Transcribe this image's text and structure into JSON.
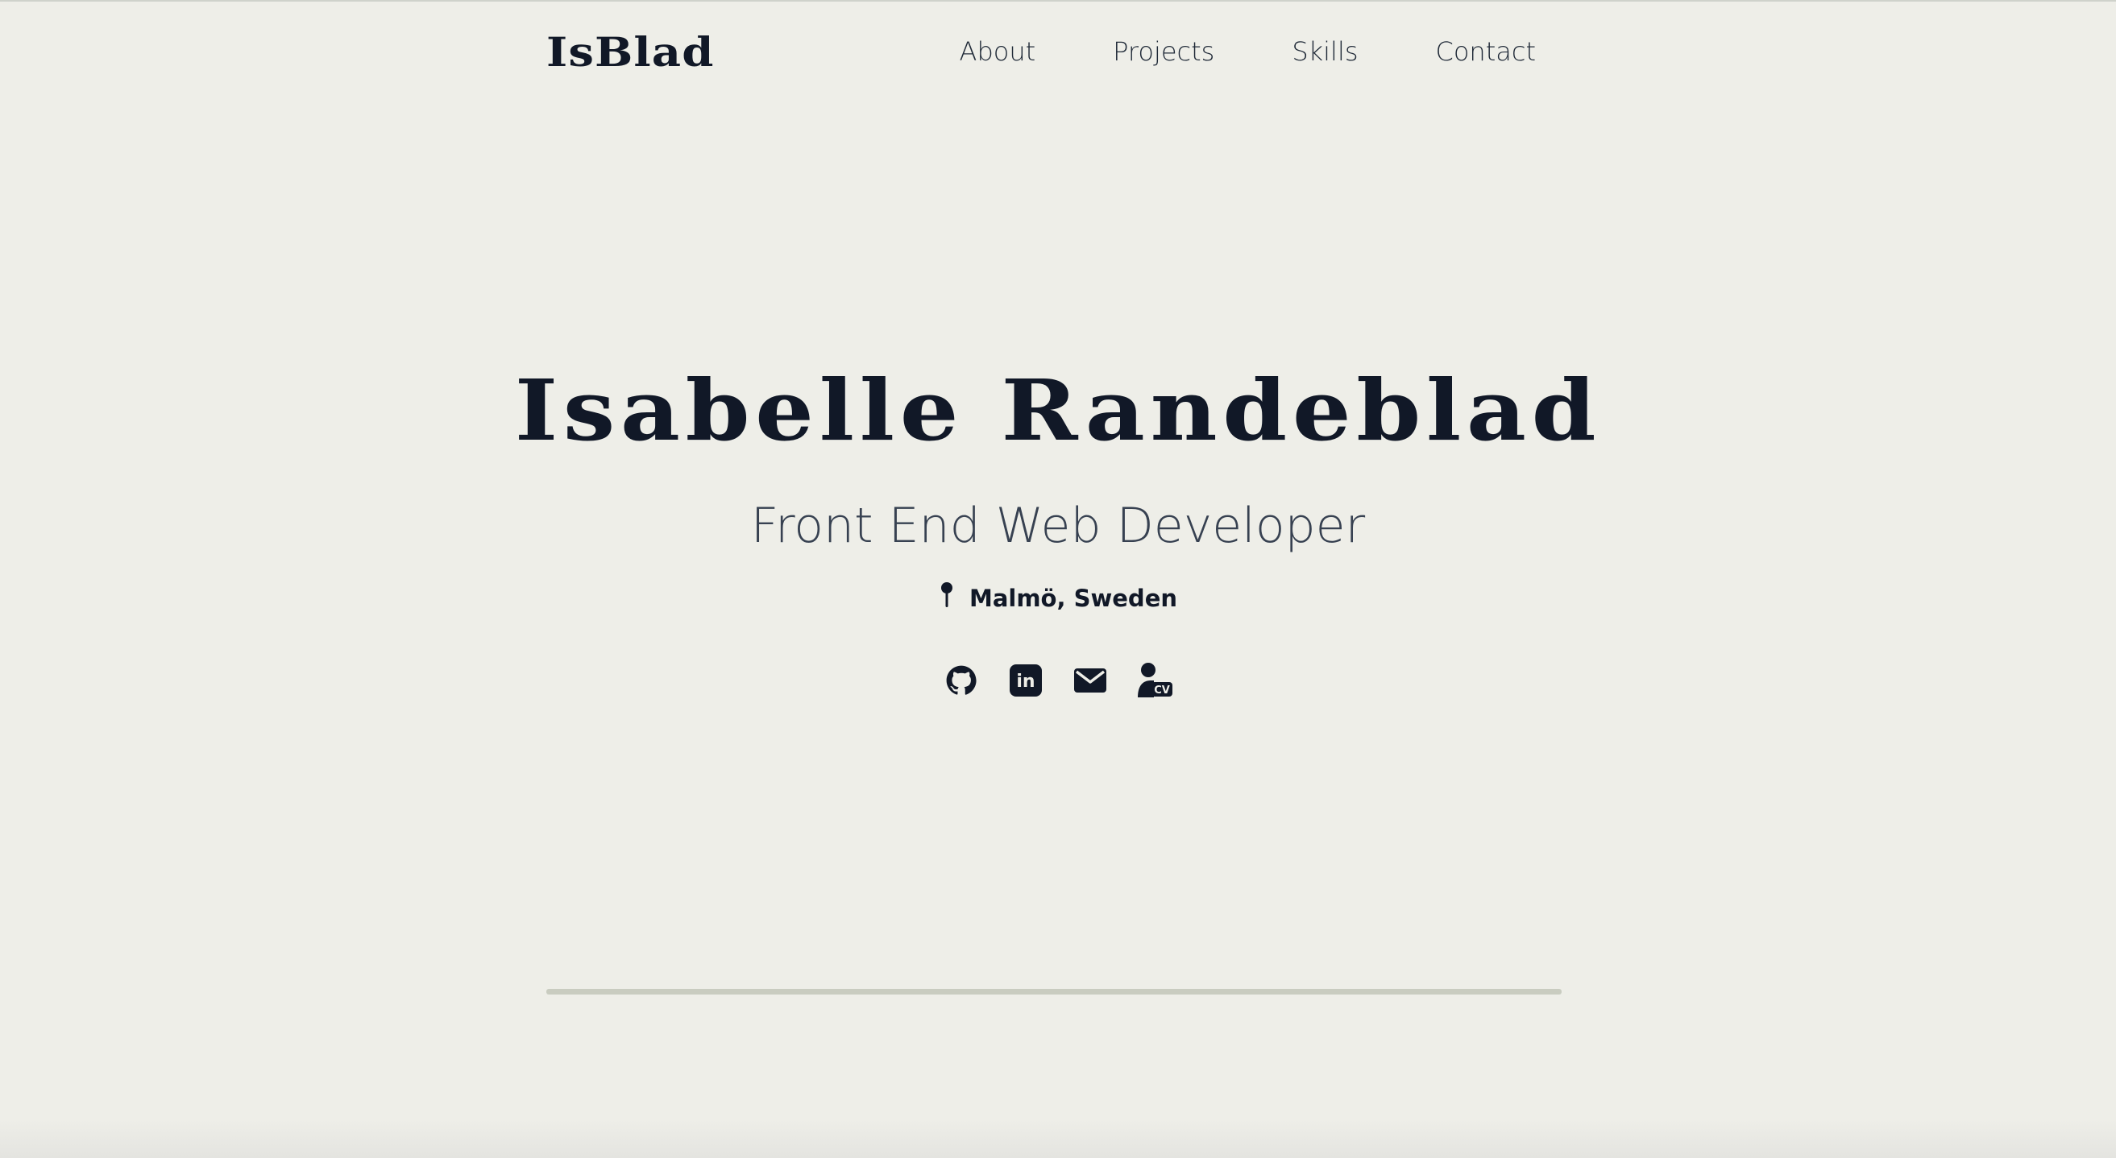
{
  "header": {
    "logo": "IsBlad",
    "nav": [
      "About",
      "Projects",
      "Skills",
      "Contact"
    ]
  },
  "hero": {
    "name": "Isabelle Randeblad",
    "title": "Front End Web Developer",
    "location": "Malmö, Sweden"
  },
  "social": {
    "icons": [
      "github-icon",
      "linkedin-icon",
      "mail-icon",
      "cv-icon"
    ],
    "cv_badge": "CV",
    "linkedin_badge": "in"
  },
  "colors": {
    "background": "#eeeee8",
    "text": "#111827",
    "subtitle": "#374151",
    "divider": "#c9ccc0"
  }
}
